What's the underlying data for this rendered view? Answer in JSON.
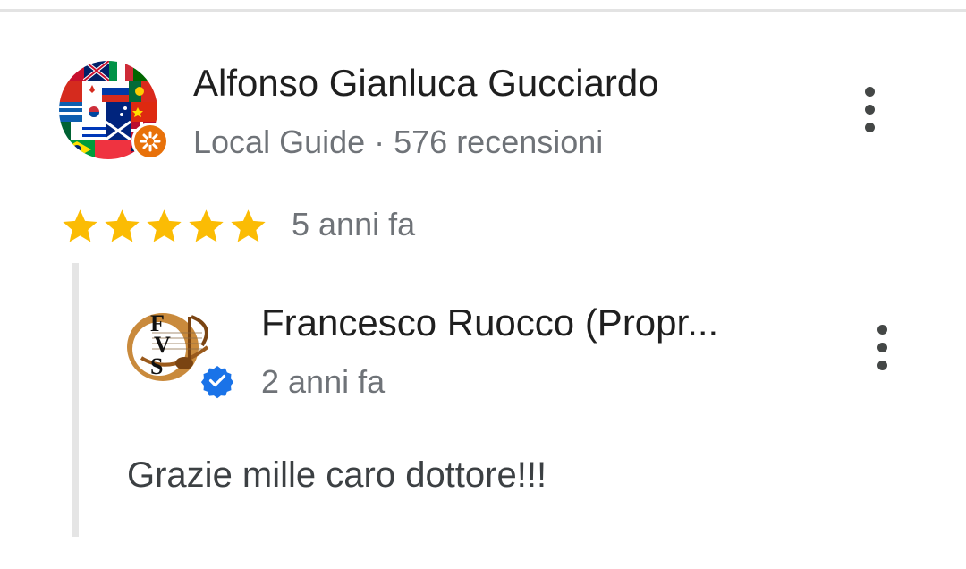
{
  "review": {
    "author_name": "Alfonso Gianluca Gucciardo",
    "author_meta": "Local Guide · 576 recensioni",
    "rating": 5,
    "rating_max": 5,
    "date": "5 anni fa",
    "avatar_icon": "world-flags-avatar-icon",
    "badge_icon": "local-guide-badge-icon",
    "menu_icon": "more-vert-icon"
  },
  "owner_reply": {
    "owner_name": "Francesco Ruocco (Propr...",
    "date": "2 anni fa",
    "text": "Grazie mille caro dottore!!!",
    "avatar_icon": "fvs-logo-icon",
    "avatar_lettering": "FVS",
    "badge_icon": "verified-badge-icon",
    "menu_icon": "more-vert-icon"
  },
  "colors": {
    "star": "#fbbc04",
    "secondary_text": "#6f7378",
    "verified": "#1a73e8",
    "guide_badge": "#e8710a"
  }
}
